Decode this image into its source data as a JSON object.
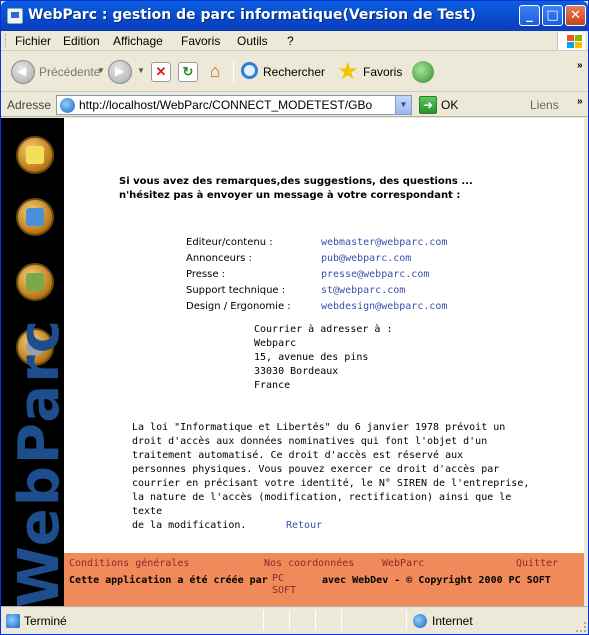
{
  "window": {
    "title": "WebParc : gestion de parc informatique(Version de Test)",
    "buttons": {
      "minimize": "_",
      "maximize": "□",
      "close": "✕"
    }
  },
  "menu": {
    "items": [
      {
        "label": "Fichier"
      },
      {
        "label": "Edition"
      },
      {
        "label": "Affichage"
      },
      {
        "label": "Favoris"
      },
      {
        "label": "Outils"
      },
      {
        "label": "?"
      }
    ]
  },
  "toolbar": {
    "back_label": "Précédente",
    "search_label": "Rechercher",
    "favorites_label": "Favoris",
    "more": "»",
    "icons": [
      "back-icon",
      "forward-icon",
      "stop-icon",
      "refresh-icon",
      "home-icon",
      "search-icon",
      "favorites-icon",
      "history-icon"
    ]
  },
  "address": {
    "label": "Adresse",
    "url": "http://localhost/WebParc/CONNECT_MODETEST/GBo",
    "go_label": "OK",
    "links_label": "Liens",
    "more": "»"
  },
  "page": {
    "intro_line1": "Si vous avez des remarques,des suggestions, des questions ...",
    "intro_line2": "n'hésitez pas à envoyer un message à votre correspondant :",
    "contacts": [
      {
        "label": "Editeur/contenu :",
        "email": "webmaster@webparc.com"
      },
      {
        "label": "Annonceurs :",
        "email": "pub@webparc.com"
      },
      {
        "label": "Presse :",
        "email": "presse@webparc.com"
      },
      {
        "label": "Support technique :",
        "email": "st@webparc.com"
      },
      {
        "label": "Design / Ergonomie :",
        "email": "webdesign@webparc.com"
      }
    ],
    "address": {
      "heading": "Courrier à adresser à :",
      "line1": "Webparc",
      "line2": "15, avenue des pins",
      "line3": "33030 Bordeaux",
      "line4": "France"
    },
    "law": {
      "l1": "La loi \"Informatique et Libertés\" du 6 janvier 1978 prévoit un",
      "l2": "droit d'accès aux données nominatives qui font l'objet d'un",
      "l3": "traitement automatisé. Ce droit d'accès est réservé aux",
      "l4": "personnes physiques. Vous pouvez exercer ce droit d'accès par",
      "l5": "courrier en précisant votre identité, le N° SIREN de l'entreprise,",
      "l6": "la nature de l'accès (modification, rectification) ainsi que le texte",
      "l7": "de la modification."
    },
    "retour": "Retour",
    "sidebar_brand": "WebParc"
  },
  "footer": {
    "conditions": "Conditions générales",
    "coordonnees": "Nos coordonnées",
    "webparc": "WebParc",
    "quitter": "Quitter",
    "made_by": "Cette application a été créée par",
    "pc": "PC",
    "soft": "SOFT",
    "copyright": "avec WebDev - © Copyright 2000 PC SOFT"
  },
  "status": {
    "text": "Terminé",
    "zone": "Internet"
  },
  "colors": {
    "titlebar": "#0a4ed0",
    "link": "#3b4fb0",
    "footer": "#f08a5a",
    "sidebar": "#000000",
    "brand": "#1d4d8c"
  }
}
